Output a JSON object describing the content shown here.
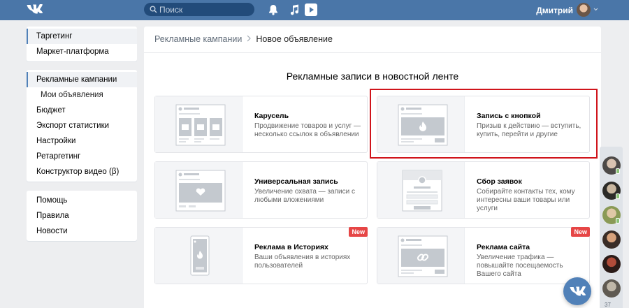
{
  "header": {
    "search_placeholder": "Поиск",
    "user_name": "Дмитрий"
  },
  "left_menu": {
    "group1": [
      "Таргетинг",
      "Маркет-платформа"
    ],
    "group2": [
      {
        "label": "Рекламные кампании",
        "active": true
      },
      {
        "label": "Мои объявления",
        "sub": true
      },
      {
        "label": "Бюджет"
      },
      {
        "label": "Экспорт статистики"
      },
      {
        "label": "Настройки"
      },
      {
        "label": "Ретаргетинг"
      },
      {
        "label": "Конструктор видео (β)"
      }
    ],
    "group3": [
      "Помощь",
      "Правила",
      "Новости"
    ]
  },
  "breadcrumb": {
    "first": "Рекламные кампании",
    "current": "Новое объявление"
  },
  "section_title": "Рекламные записи в новостной ленте",
  "cards": [
    {
      "title": "Карусель",
      "desc": "Продвижение товаров и услуг — несколько ссылок в объявлении",
      "badge": ""
    },
    {
      "title": "Запись с кнопкой",
      "desc": "Призыв к действию — вступить, купить, перейти и другие",
      "badge": ""
    },
    {
      "title": "Универсальная запись",
      "desc": "Увеличение охвата — записи с любыми вложениями",
      "badge": ""
    },
    {
      "title": "Сбор заявок",
      "desc": "Собирайте контакты тех, кому интересны ваши товары или услуги",
      "badge": ""
    },
    {
      "title": "Реклама в Историях",
      "desc": "Ваши объявления в историях пользователей",
      "badge": "New"
    },
    {
      "title": "Реклама сайта",
      "desc": "Увеличение трафика — повышайте посещаемость Вашего сайта",
      "badge": "New"
    }
  ],
  "chat": {
    "online_count": "37"
  },
  "colors": {
    "header_bg": "#4a76a8",
    "accent": "#5181b8",
    "highlight": "#d0141b",
    "badge": "#e64646"
  }
}
